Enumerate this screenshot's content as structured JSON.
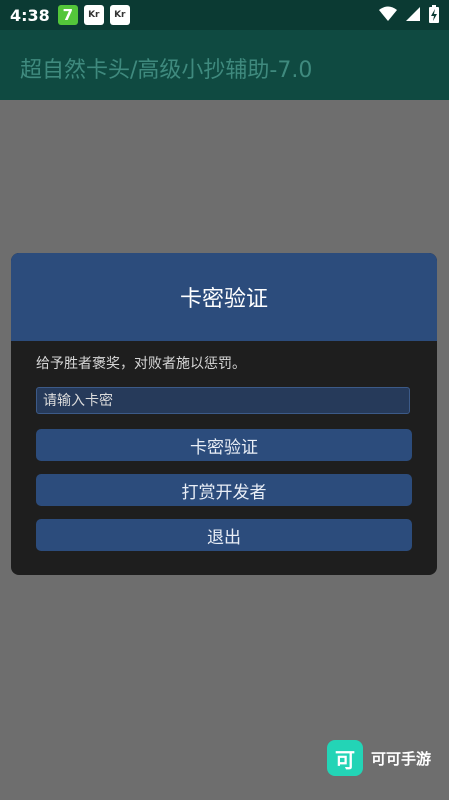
{
  "status_bar": {
    "time": "4:38",
    "notif_icons": [
      "7",
      "Kr",
      "Kr"
    ]
  },
  "app": {
    "title": "超自然卡头/高级小抄辅助-7.0"
  },
  "dialog": {
    "title": "卡密验证",
    "message": "给予胜者褒奖，对败者施以惩罚。",
    "key_input_placeholder": "请输入卡密",
    "buttons": {
      "verify": "卡密验证",
      "tip_developer": "打赏开发者",
      "exit": "退出"
    }
  },
  "watermark": {
    "logo_char": "可",
    "text": "可可手游"
  }
}
